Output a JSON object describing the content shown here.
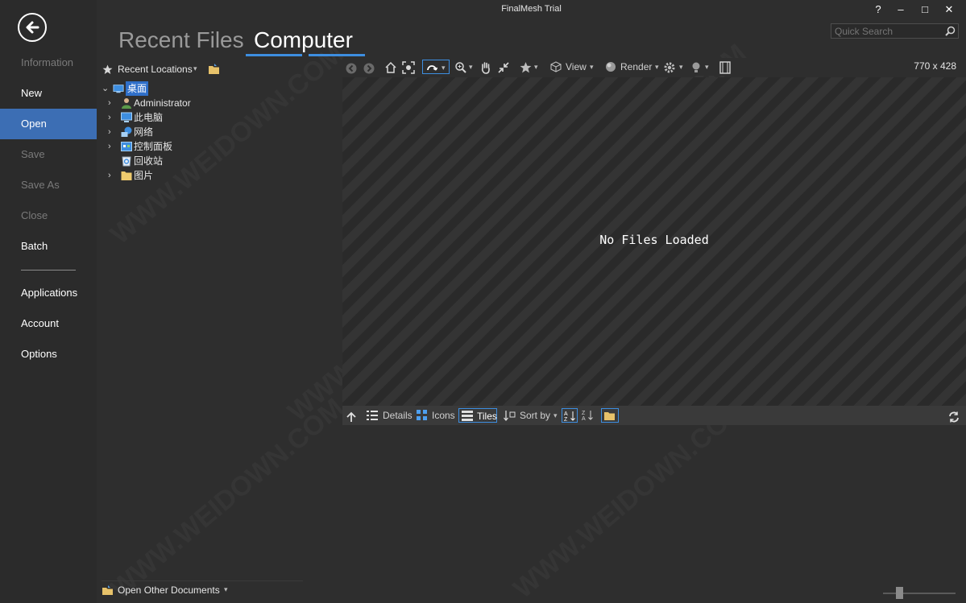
{
  "window": {
    "title": "FinalMesh  Trial",
    "help_label": "?",
    "minimize_label": "–",
    "maximize_label": "□",
    "close_label": "✕"
  },
  "search": {
    "placeholder": "Quick Search"
  },
  "nav": {
    "items": [
      {
        "label": "Information",
        "state": "disabled"
      },
      {
        "label": "New",
        "state": "normal"
      },
      {
        "label": "Open",
        "state": "active"
      },
      {
        "label": "Save",
        "state": "disabled"
      },
      {
        "label": "Save As",
        "state": "disabled"
      },
      {
        "label": "Close",
        "state": "disabled"
      },
      {
        "label": "Batch",
        "state": "normal"
      },
      {
        "label": "Applications",
        "state": "normal"
      },
      {
        "label": "Account",
        "state": "normal"
      },
      {
        "label": "Options",
        "state": "normal"
      }
    ]
  },
  "tabs": {
    "recent": "Recent Files",
    "computer": "Computer"
  },
  "tree": {
    "header": "Recent Locations",
    "items": [
      {
        "label": "桌面",
        "icon": "desktop-icon",
        "selected": true,
        "expanded": true
      },
      {
        "label": "Administrator",
        "icon": "user-icon"
      },
      {
        "label": "此电脑",
        "icon": "computer-icon"
      },
      {
        "label": "网络",
        "icon": "network-icon"
      },
      {
        "label": "控制面板",
        "icon": "control-panel-icon"
      },
      {
        "label": "回收站",
        "icon": "recycle-bin-icon"
      },
      {
        "label": "图片",
        "icon": "folder-icon"
      }
    ],
    "open_other": "Open Other Documents"
  },
  "viewer": {
    "view_label": "View",
    "render_label": "Render",
    "resolution": "770 x 428",
    "empty_message": "No Files Loaded"
  },
  "files_toolbar": {
    "details": "Details",
    "icons": "Icons",
    "tiles": "Tiles",
    "sort_by": "Sort by"
  },
  "colors": {
    "accent": "#3c6eb4",
    "highlight_border": "#3d8ee0",
    "background": "#2b2b2b"
  }
}
